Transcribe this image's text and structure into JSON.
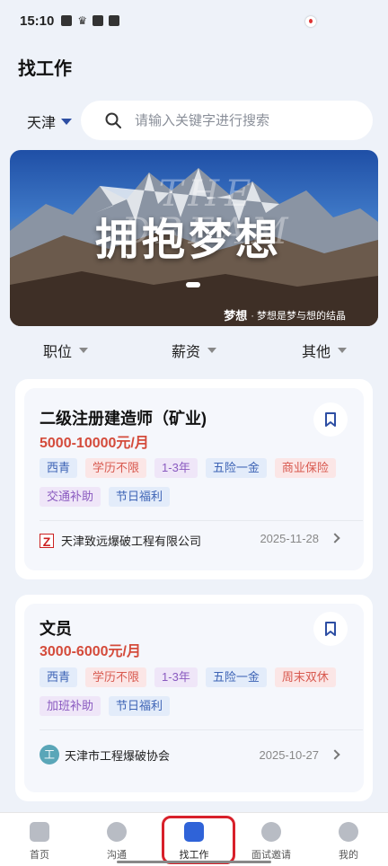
{
  "status_bar": {
    "time": "15:10"
  },
  "page": {
    "title": "找工作"
  },
  "search": {
    "city": "天津",
    "placeholder": "请输入关键字进行搜索"
  },
  "banner": {
    "headline": "拥抱梦想",
    "ghost_text_line1": "THE",
    "ghost_text_line2": "DREAM",
    "caption_bold": "梦想",
    "caption_text": "· 梦想是梦与想的结晶"
  },
  "filters": [
    {
      "label": "职位"
    },
    {
      "label": "薪资"
    },
    {
      "label": "其他"
    }
  ],
  "jobs": [
    {
      "title": "二级注册建造师（矿业)",
      "salary": "5000-10000元/月",
      "tags": [
        {
          "text": "西青",
          "color": "blue"
        },
        {
          "text": "学历不限",
          "color": "red"
        },
        {
          "text": "1-3年",
          "color": "purple"
        },
        {
          "text": "五险一金",
          "color": "blue"
        },
        {
          "text": "商业保险",
          "color": "red"
        },
        {
          "text": "交通补助",
          "color": "purple"
        },
        {
          "text": "节日福利",
          "color": "blue"
        }
      ],
      "company": "天津致远爆破工程有限公司",
      "logo_text": "Z",
      "date": "2025-11-28"
    },
    {
      "title": "文员",
      "salary": "3000-6000元/月",
      "tags": [
        {
          "text": "西青",
          "color": "blue"
        },
        {
          "text": "学历不限",
          "color": "red"
        },
        {
          "text": "1-3年",
          "color": "purple"
        },
        {
          "text": "五险一金",
          "color": "blue"
        },
        {
          "text": "周末双休",
          "color": "red"
        },
        {
          "text": "加班补助",
          "color": "purple"
        },
        {
          "text": "节日福利",
          "color": "blue"
        }
      ],
      "company": "天津市工程爆破协会",
      "logo_text": "工",
      "date": "2025-10-27"
    }
  ],
  "tabbar": [
    {
      "label": "首页",
      "icon": "home-icon"
    },
    {
      "label": "沟通",
      "icon": "chat-icon"
    },
    {
      "label": "找工作",
      "icon": "briefcase-icon",
      "active": true
    },
    {
      "label": "面试邀请",
      "icon": "person-icon"
    },
    {
      "label": "我的",
      "icon": "profile-icon"
    }
  ],
  "colors": {
    "accent": "#2f63d8",
    "salary": "#d44b3b",
    "highlight": "#d8202a"
  }
}
